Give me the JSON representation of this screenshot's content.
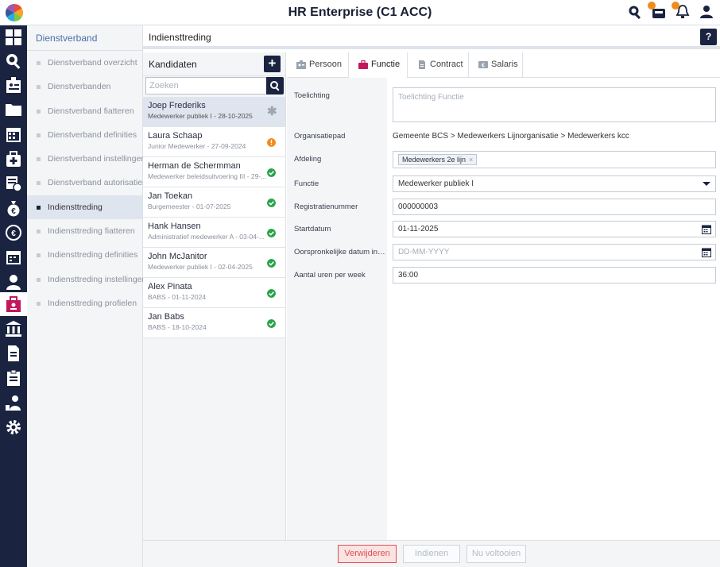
{
  "header": {
    "app_title": "HR Enterprise (C1 ACC)"
  },
  "subnav": {
    "title": "Dienstverband",
    "items": [
      {
        "label": "Dienstverband overzicht"
      },
      {
        "label": "Dienstverbanden"
      },
      {
        "label": "Dienstverband fiatteren"
      },
      {
        "label": "Dienstverband definities"
      },
      {
        "label": "Dienstverband instellingen"
      },
      {
        "label": "Dienstverband autorisaties"
      },
      {
        "label": "Indiensttreding"
      },
      {
        "label": "Indiensttreding fiatteren"
      },
      {
        "label": "Indiensttreding definities"
      },
      {
        "label": "Indiensttreding instellingen"
      },
      {
        "label": "Indiensttreding profielen"
      }
    ]
  },
  "content": {
    "title": "Indiensttreding",
    "help_label": "?"
  },
  "candidates": {
    "title": "Kandidaten",
    "add_label": "+",
    "search_placeholder": "Zoeken",
    "items": [
      {
        "name": "Joep Frederiks",
        "sub": "Medewerker publiek I - 28-10-2025",
        "status": "pending"
      },
      {
        "name": "Laura Schaap",
        "sub": "Junior Medewerker - 27-09-2024",
        "status": "warning"
      },
      {
        "name": "Herman de Schermman",
        "sub": "Medewerker beleidsuitvoering III - 29-...",
        "status": "ok"
      },
      {
        "name": "Jan Toekan",
        "sub": "Burgemeester - 01-07-2025",
        "status": "ok"
      },
      {
        "name": "Hank Hansen",
        "sub": "Administratief medewerker A - 03-04-...",
        "status": "ok"
      },
      {
        "name": "John McJanitor",
        "sub": "Medewerker publiek I - 02-04-2025",
        "status": "ok"
      },
      {
        "name": "Alex Pinata",
        "sub": "BABS - 01-11-2024",
        "status": "ok"
      },
      {
        "name": "Jan Babs",
        "sub": "BABS - 18-10-2024",
        "status": "ok"
      }
    ]
  },
  "tabs": [
    {
      "label": "Persoon"
    },
    {
      "label": "Functie"
    },
    {
      "label": "Contract"
    },
    {
      "label": "Salaris"
    }
  ],
  "form": {
    "toelichting": {
      "label": "Toelichting",
      "placeholder": "Toelichting Functie"
    },
    "organisatiepad": {
      "label": "Organisatiepad",
      "value": "Gemeente BCS > Medewerkers Lijnorganisatie > Medewerkers kcc"
    },
    "afdeling": {
      "label": "Afdeling",
      "tag": "Medewerkers 2e lijn",
      "remove": "×"
    },
    "functie": {
      "label": "Functie",
      "value": "Medewerker publiek I"
    },
    "registratienummer": {
      "label": "Registratienummer",
      "value": "000000003"
    },
    "startdatum": {
      "label": "Startdatum",
      "value": "01-11-2025"
    },
    "oorspronkelijke": {
      "label": "Oorspronkelijke datum in d...",
      "placeholder": "DD-MM-YYYY"
    },
    "uren": {
      "label": "Aantal uren per week",
      "value": "36:00"
    }
  },
  "footer": {
    "delete_label": "Verwijderen",
    "submit_label": "Indienen",
    "complete_label": "Nu voltooien"
  },
  "colors": {
    "navy": "#1a2340",
    "accent_pink": "#c2185b",
    "ok": "#2aa44a",
    "warning": "#f08c1c",
    "danger": "#d9534f"
  }
}
